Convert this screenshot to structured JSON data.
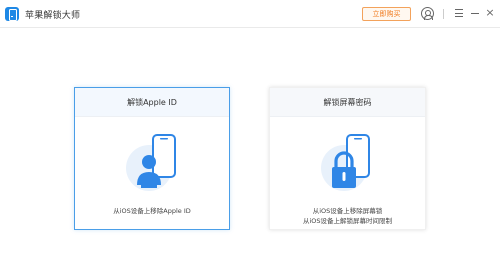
{
  "app": {
    "title": "苹果解锁大师",
    "buy_label": "立即购买",
    "accent_color": "#1e88e5",
    "buy_color": "#f07a1e"
  },
  "titlebar_icons": [
    "app-logo-icon",
    "user-icon",
    "menu-icon",
    "minimize-icon",
    "close-icon"
  ],
  "close_glyph": "×",
  "cards": [
    {
      "title": "解锁Apple ID",
      "icon": "phone-user-icon",
      "desc_lines": [
        "从iOS设备上移除Apple ID"
      ],
      "selected": true
    },
    {
      "title": "解锁屏幕密码",
      "icon": "phone-lock-icon",
      "desc_lines": [
        "从iOS设备上移除屏幕锁",
        "从iOS设备上解锁屏幕时间限制"
      ],
      "selected": false
    }
  ]
}
